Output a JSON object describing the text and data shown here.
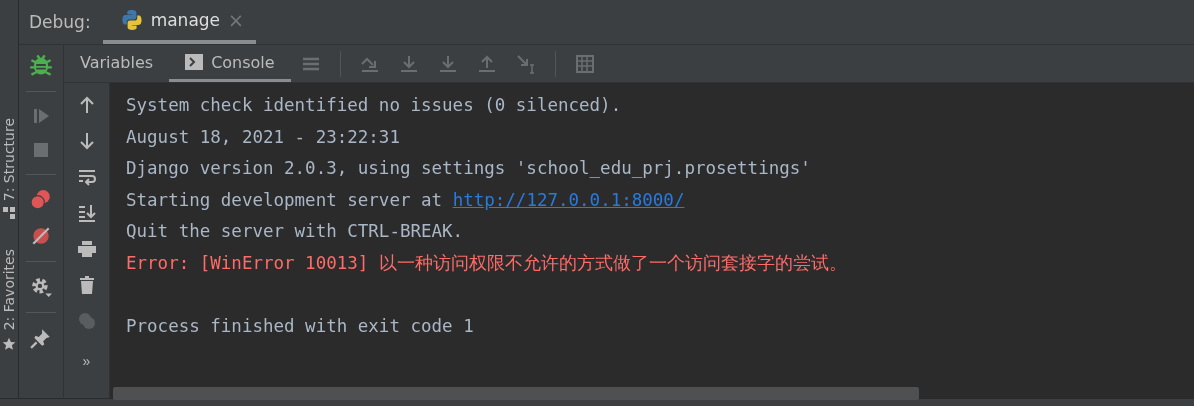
{
  "header": {
    "label": "Debug:",
    "tab": {
      "label": "manage",
      "close": "×",
      "selected": true
    }
  },
  "side_panels": [
    {
      "label": "7: Structure",
      "kind": "structure"
    },
    {
      "label": "2: Favorites",
      "kind": "favorites"
    }
  ],
  "subtabs": [
    {
      "label": "Variables",
      "selected": false
    },
    {
      "label": "Console",
      "selected": true
    }
  ],
  "console": {
    "lines": [
      {
        "kind": "plain",
        "text": "System check identified no issues (0 silenced)."
      },
      {
        "kind": "plain",
        "text": "August 18, 2021 - 23:22:31"
      },
      {
        "kind": "plain",
        "text": "Django version 2.0.3, using settings 'school_edu_prj.prosettings'"
      },
      {
        "kind": "link",
        "text": "Starting development server at ",
        "link": "http://127.0.0.1:8000/"
      },
      {
        "kind": "plain",
        "text": "Quit the server with CTRL-BREAK."
      },
      {
        "kind": "error",
        "text": "Error: [WinError 10013] 以一种访问权限不允许的方式做了一个访问套接字的尝试。"
      },
      {
        "kind": "blank"
      },
      {
        "kind": "plain",
        "text": "Process finished with exit code 1"
      }
    ]
  },
  "more": "»"
}
